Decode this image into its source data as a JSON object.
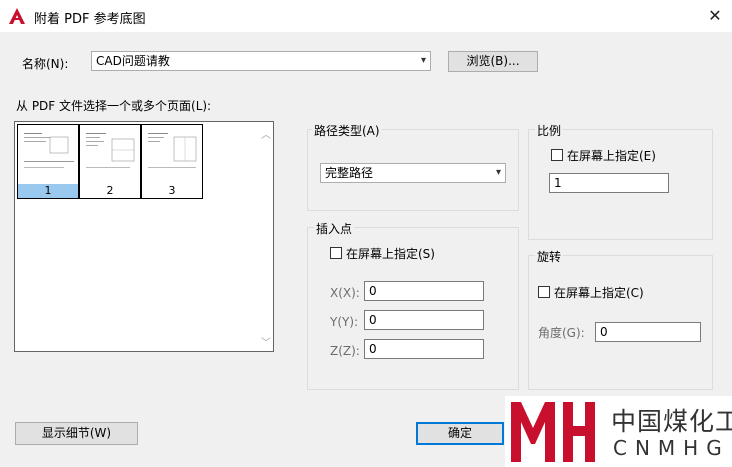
{
  "window": {
    "title": "附着 PDF 参考底图",
    "close_glyph": "✕"
  },
  "name_field": {
    "label": "名称(N):",
    "value": "CAD问题请教",
    "browse_label": "浏览(B)..."
  },
  "page_select": {
    "label": "从 PDF 文件选择一个或多个页面(L):",
    "pages": [
      {
        "number": "1",
        "selected": true
      },
      {
        "number": "2",
        "selected": false
      },
      {
        "number": "3",
        "selected": false
      }
    ]
  },
  "path_type": {
    "title": "路径类型(A)",
    "value": "完整路径"
  },
  "insertion_point": {
    "title": "插入点",
    "specify_on_screen": "在屏幕上指定(S)",
    "x_label": "X(X):",
    "x_value": "0",
    "y_label": "Y(Y):",
    "y_value": "0",
    "z_label": "Z(Z):",
    "z_value": "0"
  },
  "scale": {
    "title": "比例",
    "specify_on_screen": "在屏幕上指定(E)",
    "value": "1"
  },
  "rotation": {
    "title": "旋转",
    "specify_on_screen": "在屏幕上指定(C)",
    "angle_label": "角度(G):",
    "angle_value": "0"
  },
  "buttons": {
    "show_details": "显示细节(W)",
    "ok": "确定"
  },
  "watermark": {
    "text_cn": "中国煤化工",
    "text_en": "CNMHG"
  },
  "colors": {
    "accent": "#0078d7",
    "selected_page": "#99c9ef",
    "watermark_red": "#c8102e"
  }
}
